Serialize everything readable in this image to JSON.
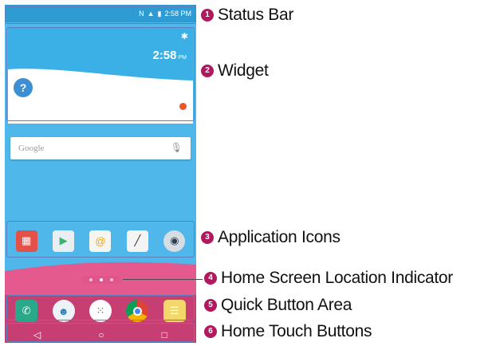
{
  "status_bar": {
    "time": "2:58 PM",
    "icons": [
      "nfc-icon",
      "signal-icon",
      "battery-icon"
    ]
  },
  "widget": {
    "time": "2:58",
    "ampm": "PM",
    "help_symbol": "?"
  },
  "search_bar": {
    "label": "Google"
  },
  "app_icons": [
    "folder-icon",
    "play-store-icon",
    "email-icon",
    "pen-icon",
    "camera-icon"
  ],
  "location_indicator": {
    "pages": 3,
    "active_page": 2
  },
  "quick_buttons": [
    "phone-icon",
    "contacts-icon",
    "apps-icon",
    "chrome-icon",
    "messaging-icon"
  ],
  "home_buttons": [
    "back-icon",
    "home-icon",
    "recent-apps-icon"
  ],
  "callouts": [
    {
      "number": "1",
      "label": "Status Bar"
    },
    {
      "number": "2",
      "label": "Widget"
    },
    {
      "number": "3",
      "label": "Application Icons"
    },
    {
      "number": "4",
      "label": "Home Screen Location Indicator"
    },
    {
      "number": "5",
      "label": "Quick Button Area"
    },
    {
      "number": "6",
      "label": "Home Touch Buttons"
    }
  ],
  "colors": {
    "badge": "#b0195e",
    "frame": "#5c7fc0",
    "screen_blue": "#4fb7ea",
    "status_blue": "#2f9bd3",
    "pink_band": "#e45a8f",
    "dock_dark": "#c73f72"
  }
}
